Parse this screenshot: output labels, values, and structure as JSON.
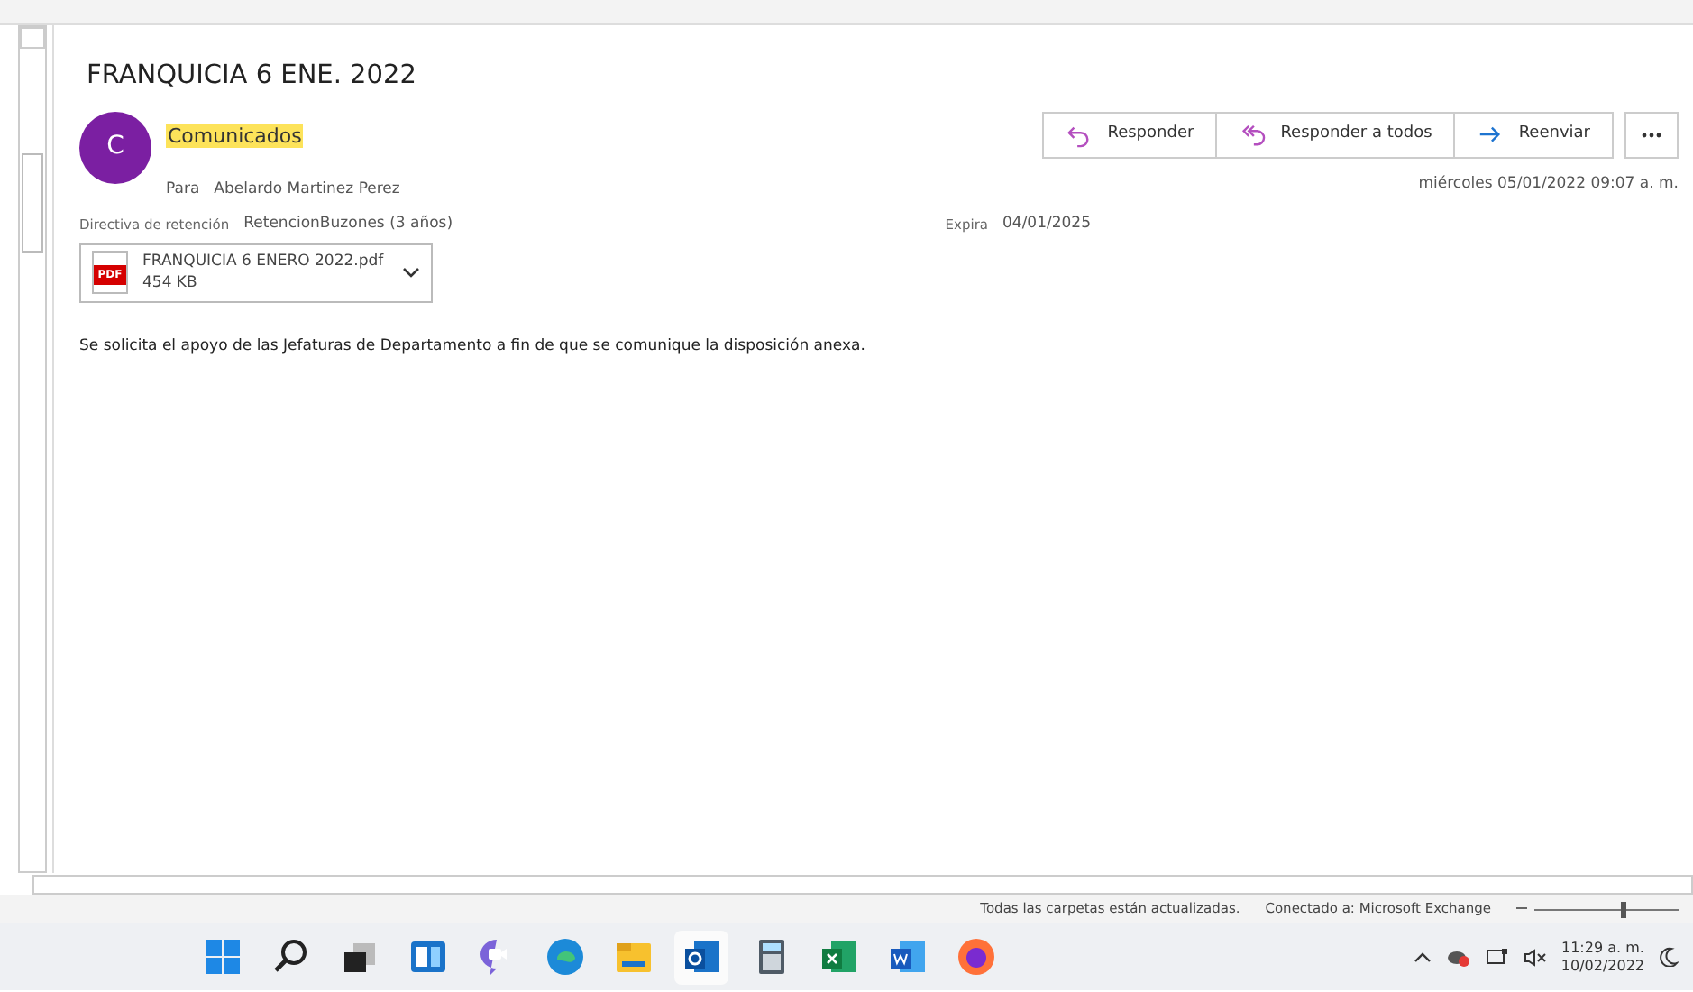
{
  "message": {
    "subject": "FRANQUICIA 6 ENE. 2022",
    "avatar_letter": "C",
    "sender": "Comunicados",
    "to_label": "Para",
    "to": "Abelardo Martinez Perez",
    "retention_label": "Directiva de retención",
    "retention": "RetencionBuzones (3 años)",
    "expires_label": "Expira",
    "expires": "04/01/2025",
    "date": "miércoles 05/01/2022 09:07 a. m.",
    "actions": [
      {
        "kind": "reply",
        "label": "Responder"
      },
      {
        "kind": "reply-all",
        "label": "Responder a todos"
      },
      {
        "kind": "forward",
        "label": "Reenviar"
      }
    ],
    "attachment": {
      "badge": "PDF",
      "name": "FRANQUICIA 6 ENERO 2022.pdf",
      "size": "454 KB"
    },
    "body": "Se solicita el apoyo de las Jefaturas de Departamento a fin de que se comunique la disposición anexa."
  },
  "status_bar": {
    "sync": "Todas las carpetas están actualizadas.",
    "connection": "Conectado a: Microsoft Exchange",
    "zoom": {
      "level": 0.6
    }
  },
  "taskbar": {
    "apps": [
      {
        "kind": "start",
        "selected": false
      },
      {
        "kind": "search",
        "selected": false
      },
      {
        "kind": "taskview",
        "selected": false
      },
      {
        "kind": "widgets",
        "selected": false
      },
      {
        "kind": "chat",
        "selected": false
      },
      {
        "kind": "edge",
        "selected": false
      },
      {
        "kind": "explorer",
        "selected": false
      },
      {
        "kind": "outlook",
        "selected": true
      },
      {
        "kind": "calculator",
        "selected": false
      },
      {
        "kind": "excel",
        "selected": false
      },
      {
        "kind": "word",
        "selected": false
      },
      {
        "kind": "firefox",
        "selected": false
      }
    ],
    "time": "11:29 a. m.",
    "date": "10/02/2022"
  }
}
